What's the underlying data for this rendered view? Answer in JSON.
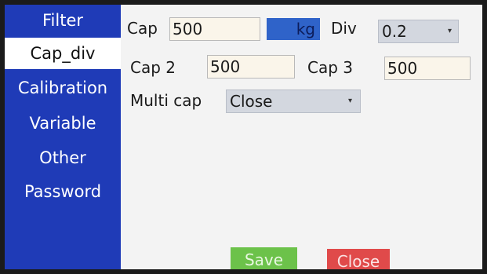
{
  "sidebar": {
    "items": [
      {
        "label": "Filter"
      },
      {
        "label": "Cap_div"
      },
      {
        "label": "Calibration"
      },
      {
        "label": "Variable"
      },
      {
        "label": "Other"
      },
      {
        "label": "Password"
      }
    ],
    "active": "Cap_div"
  },
  "main": {
    "cap": {
      "label": "Cap",
      "value": "500",
      "unit": "kg"
    },
    "div": {
      "label": "Div",
      "value": "0.2"
    },
    "cap2": {
      "label": "Cap 2",
      "value": "500"
    },
    "cap3": {
      "label": "Cap 3",
      "value": "500"
    },
    "multi_cap": {
      "label": "Multi cap",
      "value": "Close"
    }
  },
  "actions": {
    "save_label": "Save",
    "close_label": "Close"
  },
  "colors": {
    "sidebar_bg": "#1f3bb7",
    "unit_bg": "#2f63c9",
    "save_bg": "#6cc24a",
    "close_bg": "#e04a4a"
  }
}
